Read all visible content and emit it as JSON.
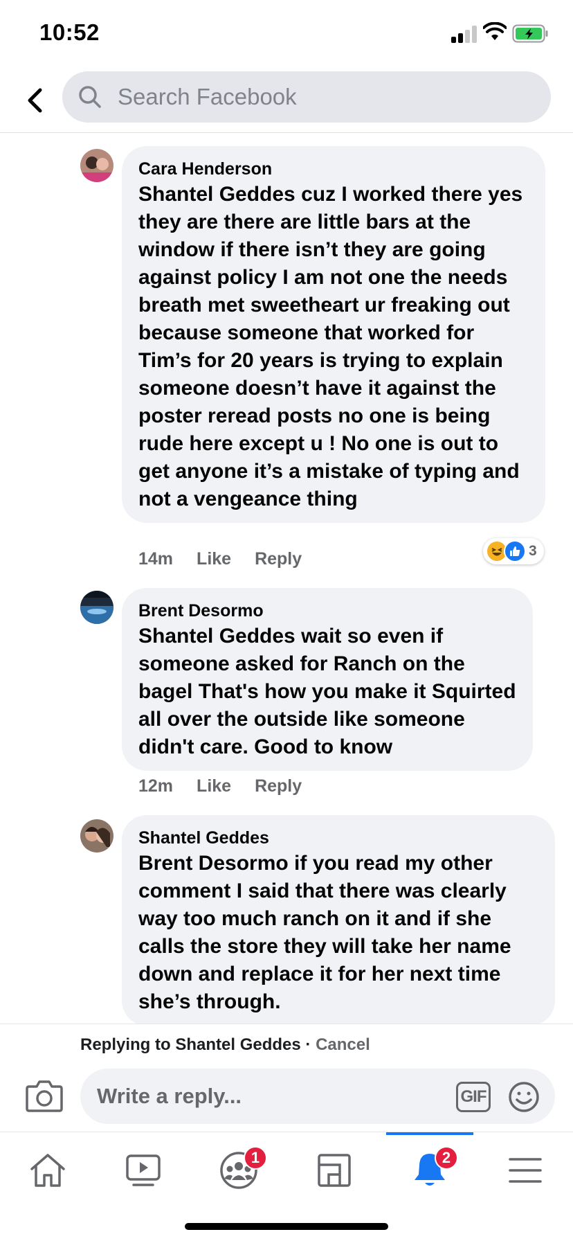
{
  "status_bar": {
    "time": "10:52"
  },
  "header": {
    "search_placeholder": "Search Facebook",
    "back_icon": "chevron-left-icon",
    "search_icon": "search-icon"
  },
  "comments": [
    {
      "author": "Cara Henderson",
      "mention": "Shantel Geddes",
      "text": " cuz I worked there yes they are there are little bars at the window if there isn’t they are going against policy I am not one the needs breath met sweetheart ur freaking out because someone that worked for Tim’s for 20 years is trying to explain someone doesn’t have it against the poster reread posts no one is being rude here except u !  No one is out to get anyone it’s a mistake of typing and not a vengeance thing",
      "time": "14m",
      "like": "Like",
      "reply": "Reply",
      "reaction_count": "3"
    },
    {
      "author": "Brent Desormo",
      "mention": "Shantel Geddes",
      "text": " wait so even if someone asked for Ranch on the bagel That's how you make it Squirted all over the outside like someone didn't care. Good to know",
      "time": "12m",
      "like": "Like",
      "reply": "Reply"
    },
    {
      "author": "Shantel Geddes",
      "mention": "Brent Desormo",
      "text": " if you read my other comment I said that there was clearly way too much ranch on it and if she calls the store they will take her name down and replace it for her next time she’s through."
    }
  ],
  "composer": {
    "replying_prefix": "Replying to ",
    "replying_name": "Shantel Geddes",
    "separator": " · ",
    "cancel": "Cancel",
    "placeholder": "Write a reply...",
    "gif_label": "GIF"
  },
  "nav": {
    "items": [
      {
        "icon": "home-icon"
      },
      {
        "icon": "watch-icon"
      },
      {
        "icon": "groups-icon",
        "badge": "1"
      },
      {
        "icon": "pages-icon"
      },
      {
        "icon": "notifications-icon",
        "badge": "2",
        "active": true
      },
      {
        "icon": "menu-icon"
      }
    ]
  },
  "colors": {
    "accent": "#1877f2",
    "badge": "#e41e3f",
    "bubble": "#f0f2f5",
    "muted_text": "#65676b"
  }
}
